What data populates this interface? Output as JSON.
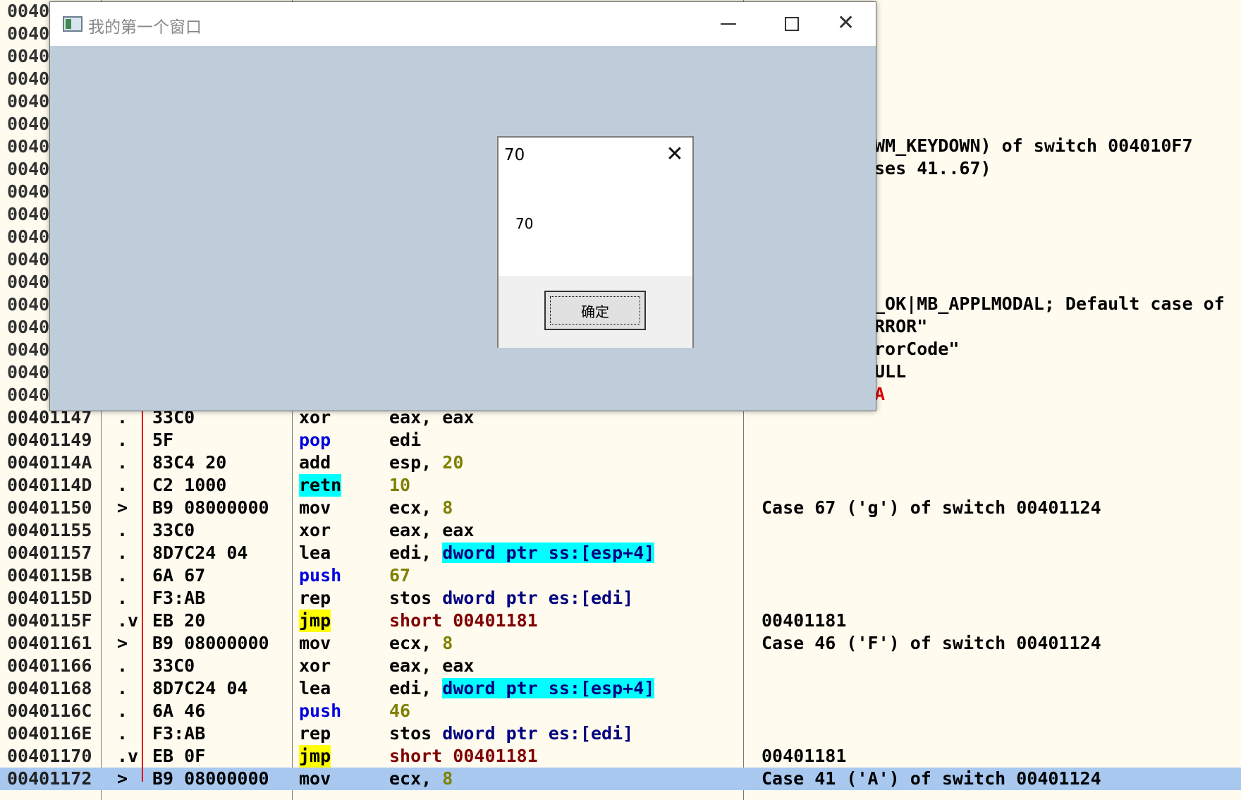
{
  "addr_prefix": "0040",
  "comments_top": {
    "c1": "WM_KEYDOWN) of switch 004010F7",
    "c2": "ses 41..67)",
    "c3": "_OK|MB_APPLMODAL; Default case of",
    "c4": "RROR\"",
    "c5": "rorCode\"",
    "c6": "ULL",
    "c7": "A"
  },
  "rows": [
    {
      "addr": "00401147",
      "mark": ".",
      "hex": "33C0",
      "mn": "xor",
      "op": "eax, eax",
      "cmt": ""
    },
    {
      "addr": "00401149",
      "mark": ".",
      "hex": "5F",
      "mn": "pop",
      "op": "edi",
      "cmt": ""
    },
    {
      "addr": "0040114A",
      "mark": ".",
      "hex": "83C4 20",
      "mn": "add",
      "op": "esp, 20",
      "cmt": ""
    },
    {
      "addr": "0040114D",
      "mark": ".",
      "hex": "C2 1000",
      "mn": "retn",
      "op": "10",
      "cmt": ""
    },
    {
      "addr": "00401150",
      "mark": ">",
      "hex": "B9 08000000",
      "mn": "mov",
      "op": "ecx, 8",
      "cmt": "Case 67 ('g') of switch 00401124"
    },
    {
      "addr": "00401155",
      "mark": ".",
      "hex": "33C0",
      "mn": "xor",
      "op": "eax, eax",
      "cmt": ""
    },
    {
      "addr": "00401157",
      "mark": ".",
      "hex": "8D7C24 04",
      "mn": "lea",
      "op": "edi, dword ptr ss:[esp+4]",
      "cmt": ""
    },
    {
      "addr": "0040115B",
      "mark": ".",
      "hex": "6A 67",
      "mn": "push",
      "op": "67",
      "cmt": ""
    },
    {
      "addr": "0040115D",
      "mark": ".",
      "hex": "F3:AB",
      "mn": "rep",
      "op": "stos dword ptr es:[edi]",
      "cmt": ""
    },
    {
      "addr": "0040115F",
      "mark": ".v",
      "hex": "EB 20",
      "mn": "jmp",
      "op": "short 00401181",
      "cmt": "00401181"
    },
    {
      "addr": "00401161",
      "mark": ">",
      "hex": "B9 08000000",
      "mn": "mov",
      "op": "ecx, 8",
      "cmt": "Case 46 ('F') of switch 00401124"
    },
    {
      "addr": "00401166",
      "mark": ".",
      "hex": "33C0",
      "mn": "xor",
      "op": "eax, eax",
      "cmt": ""
    },
    {
      "addr": "00401168",
      "mark": ".",
      "hex": "8D7C24 04",
      "mn": "lea",
      "op": "edi, dword ptr ss:[esp+4]",
      "cmt": ""
    },
    {
      "addr": "0040116C",
      "mark": ".",
      "hex": "6A 46",
      "mn": "push",
      "op": "46",
      "cmt": ""
    },
    {
      "addr": "0040116E",
      "mark": ".",
      "hex": "F3:AB",
      "mn": "rep",
      "op": "stos dword ptr es:[edi]",
      "cmt": ""
    },
    {
      "addr": "00401170",
      "mark": ".v",
      "hex": "EB 0F",
      "mn": "jmp",
      "op": "short 00401181",
      "cmt": "00401181"
    },
    {
      "addr": "00401172",
      "mark": ">",
      "hex": "B9 08000000",
      "mn": "mov",
      "op": "ecx, 8",
      "cmt": "Case 41 ('A') of switch 00401124"
    }
  ],
  "colors": {
    "selection": "#a8c8f0",
    "jmp_hl": "#ffff00",
    "cyan_hl": "#00ffff",
    "number": "#808000",
    "jmp_target": "#800000",
    "mnem_blue": "#0000e0",
    "ptr_navy": "#000080"
  },
  "main_window": {
    "title": "我的第一个窗口",
    "minimize_icon": "minimize-icon",
    "maximize_icon": "maximize-icon",
    "close_icon": "close-icon"
  },
  "message_box": {
    "title": "70",
    "text": "70",
    "ok_label": "确定",
    "close_icon": "close-icon"
  }
}
